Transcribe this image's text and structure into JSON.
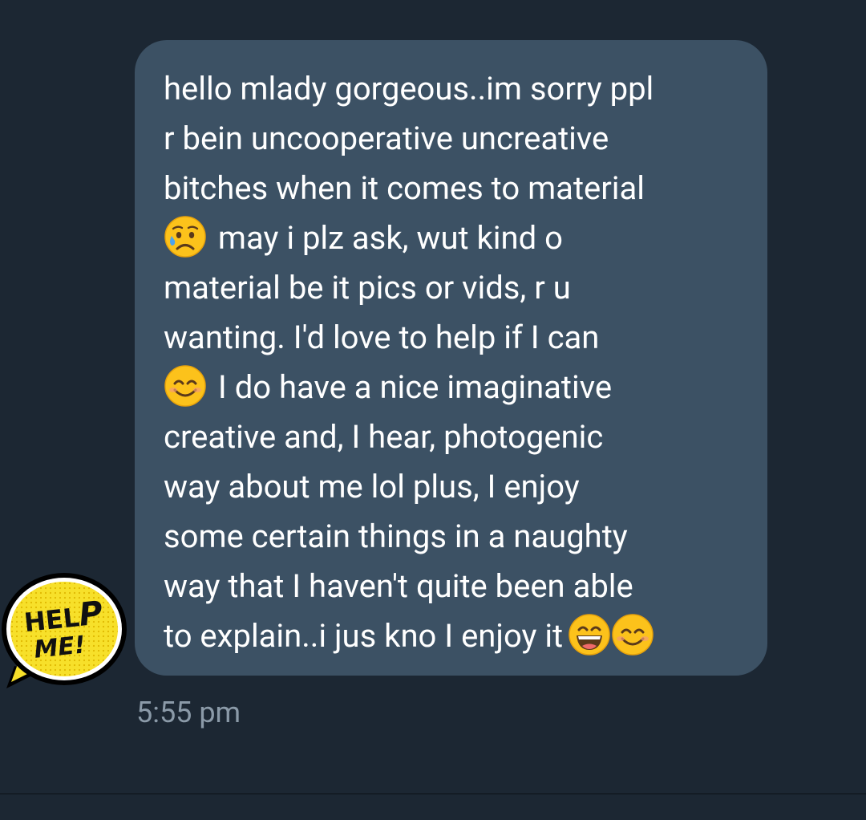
{
  "message": {
    "lines": [
      {
        "emoji": null,
        "text": "hello mlady gorgeous..im sorry ppl"
      },
      {
        "emoji": null,
        "text": "r bein uncooperative uncreative"
      },
      {
        "emoji": null,
        "text": "bitches when it comes to material"
      },
      {
        "emoji": "sad-sweat-face",
        "text": "may i plz ask, wut kind o"
      },
      {
        "emoji": null,
        "text": "material be it pics or vids, r u"
      },
      {
        "emoji": null,
        "text": "wanting. I'd love to help if I can"
      },
      {
        "emoji": "smiling-face",
        "text": "I do have a nice imaginative"
      },
      {
        "emoji": null,
        "text": "creative and, I hear, photogenic"
      },
      {
        "emoji": null,
        "text": "way about me lol plus, I enjoy"
      },
      {
        "emoji": null,
        "text": "some certain things in a naughty"
      },
      {
        "emoji": null,
        "text": "way that I haven't quite been able"
      },
      {
        "emoji": null,
        "text": "to explain..i jus kno I enjoy it",
        "trailing_emojis": [
          "grinning-face",
          "smiling-face"
        ]
      }
    ],
    "timestamp": "5:55 pm"
  },
  "avatar": {
    "line1": "HEL",
    "line1_accent": "P",
    "line2": "ME!",
    "background_color": "#f7e02a"
  },
  "colors": {
    "background": "#1c2733",
    "bubble": "#3c5164",
    "text": "#ffffff",
    "timestamp": "#8b9aa8"
  }
}
